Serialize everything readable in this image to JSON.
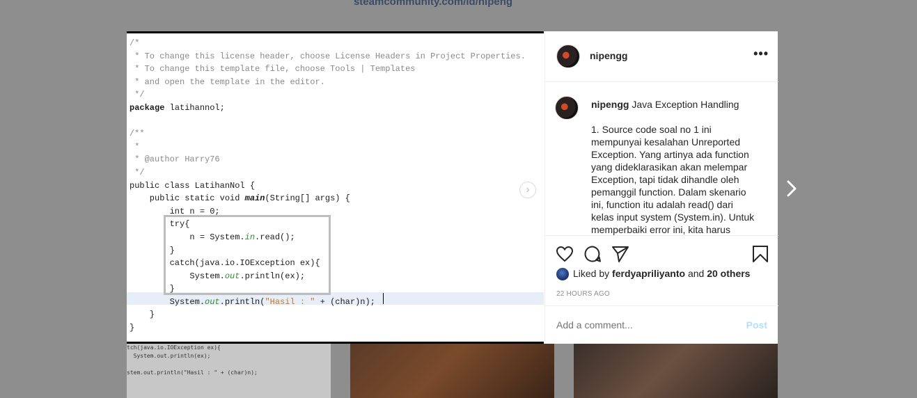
{
  "background": {
    "link_text": "steamcommunity.com/id/nipeng",
    "thumb1_lines": [
      "tch(java.io.IOException ex){",
      "  System.out.println(ex);",
      "",
      "stem.out.println(\"Hasil : \" + (char)n);"
    ]
  },
  "code": {
    "comment_block": [
      "/*",
      " * To change this license header, choose License Headers in Project Properties.",
      " * To change this template file, choose Tools | Templates",
      " * and open the template in the editor.",
      " */"
    ],
    "package_kw": "package",
    "package_name": " latihannol;",
    "doc_block": [
      "/**",
      " *",
      " * @author Harry76",
      " */"
    ],
    "class_decl": "public class LatihanNol {",
    "main_prefix": "    public static void ",
    "main_name": "main",
    "main_suffix": "(String[] args) {",
    "int_line": "        int n = 0;",
    "try_line": "        try{",
    "read_prefix": "            n = System.",
    "read_in": "in",
    "read_suffix": ".read();",
    "close1": "        }",
    "catch_line": "        catch(java.io.IOException ex){",
    "println_prefix": "            System.",
    "println_out": "out",
    "println_suffix": ".println(ex);",
    "close2": "        }",
    "hasil_prefix": "        System.",
    "hasil_out": "out",
    "hasil_mid": ".println(",
    "hasil_str": "\"Hasil : \"",
    "hasil_suffix": " + (char)n);",
    "close3": "    }",
    "close4": "}"
  },
  "post": {
    "username": "nipengg",
    "caption_title": "Java Exception Handling",
    "caption_body": "1. Source code soal no 1 ini mempunyai kesalahan Unreported Exception. Yang artinya ada function yang dideklarasikan akan melempar Exception, tapi tidak dihandle oleh pemanggil function. Dalam skenario ini, function itu adalah read() dari kelas input system (System.in). Untuk memperbaiki error ini, kita harus",
    "liked_by_prefix": "Liked by",
    "liked_by_user": "ferdyapriliyanto",
    "liked_and": "and",
    "liked_others": "20 others",
    "timestamp": "22 HOURS AGO",
    "comment_placeholder": "Add a comment...",
    "post_label": "Post"
  },
  "icons": {
    "more": "more-horizontal-icon",
    "like": "heart-icon",
    "comment": "comment-bubble-icon",
    "share": "paper-plane-icon",
    "save": "bookmark-icon",
    "next_image": "chevron-right-icon",
    "next_post": "chevron-right-icon"
  },
  "colors": {
    "overlay": "#8e8e8e",
    "text": "#262626",
    "muted": "#8e8e8e",
    "post_disabled": "#b2dffc"
  }
}
